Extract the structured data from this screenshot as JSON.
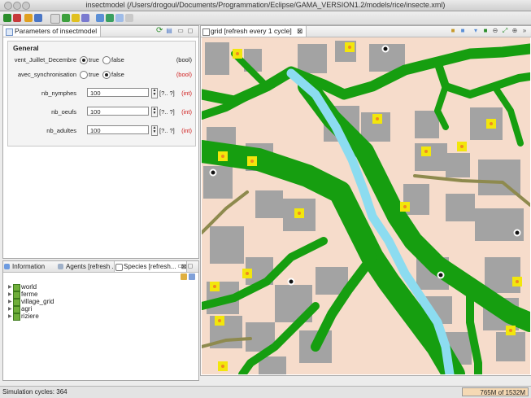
{
  "window": {
    "title": "insectmodel (/Users/drogoul/Documents/Programmation/Eclipse/GAMA_VERSION1.2/models/rice/insecte.xml)"
  },
  "params_view": {
    "tab_label": "Parameters of insectmodel",
    "section_title": "General",
    "rows": [
      {
        "label": "vent_Juillet_Decembre",
        "options": [
          "true",
          "false"
        ],
        "selected": "true",
        "type": "(bool)",
        "type_red": false
      },
      {
        "label": "avec_synchronisation",
        "options": [
          "true",
          "false"
        ],
        "selected": "false",
        "type": "(bool)",
        "type_red": true
      },
      {
        "label": "nb_nymphes",
        "value": "100",
        "range": "[?.. ?]",
        "type": "(int)",
        "type_red": true
      },
      {
        "label": "nb_oeufs",
        "value": "100",
        "range": "[?.. ?]",
        "type": "(int)",
        "type_red": true
      },
      {
        "label": "nb_adultes",
        "value": "100",
        "range": "[?.. ?]",
        "type": "(int)",
        "type_red": true
      }
    ]
  },
  "species_view": {
    "tabs": [
      "Information",
      "Agents [refresh ...",
      "Species [refresh..."
    ],
    "items": [
      "world",
      "ferme",
      "village_grid",
      "agri",
      "riziere"
    ]
  },
  "grid_view": {
    "tab_label": "grid [refresh every 1 cycle]"
  },
  "status": {
    "text": "Simulation cycles: 364",
    "memory": "765M of 1532M"
  },
  "colors": {
    "land": "#f6dccb",
    "rice": "#169e10",
    "river": "#8cdcf0",
    "road": "#8e8a4e",
    "field": "#a3a3a3",
    "farm": "#f2e60c"
  }
}
